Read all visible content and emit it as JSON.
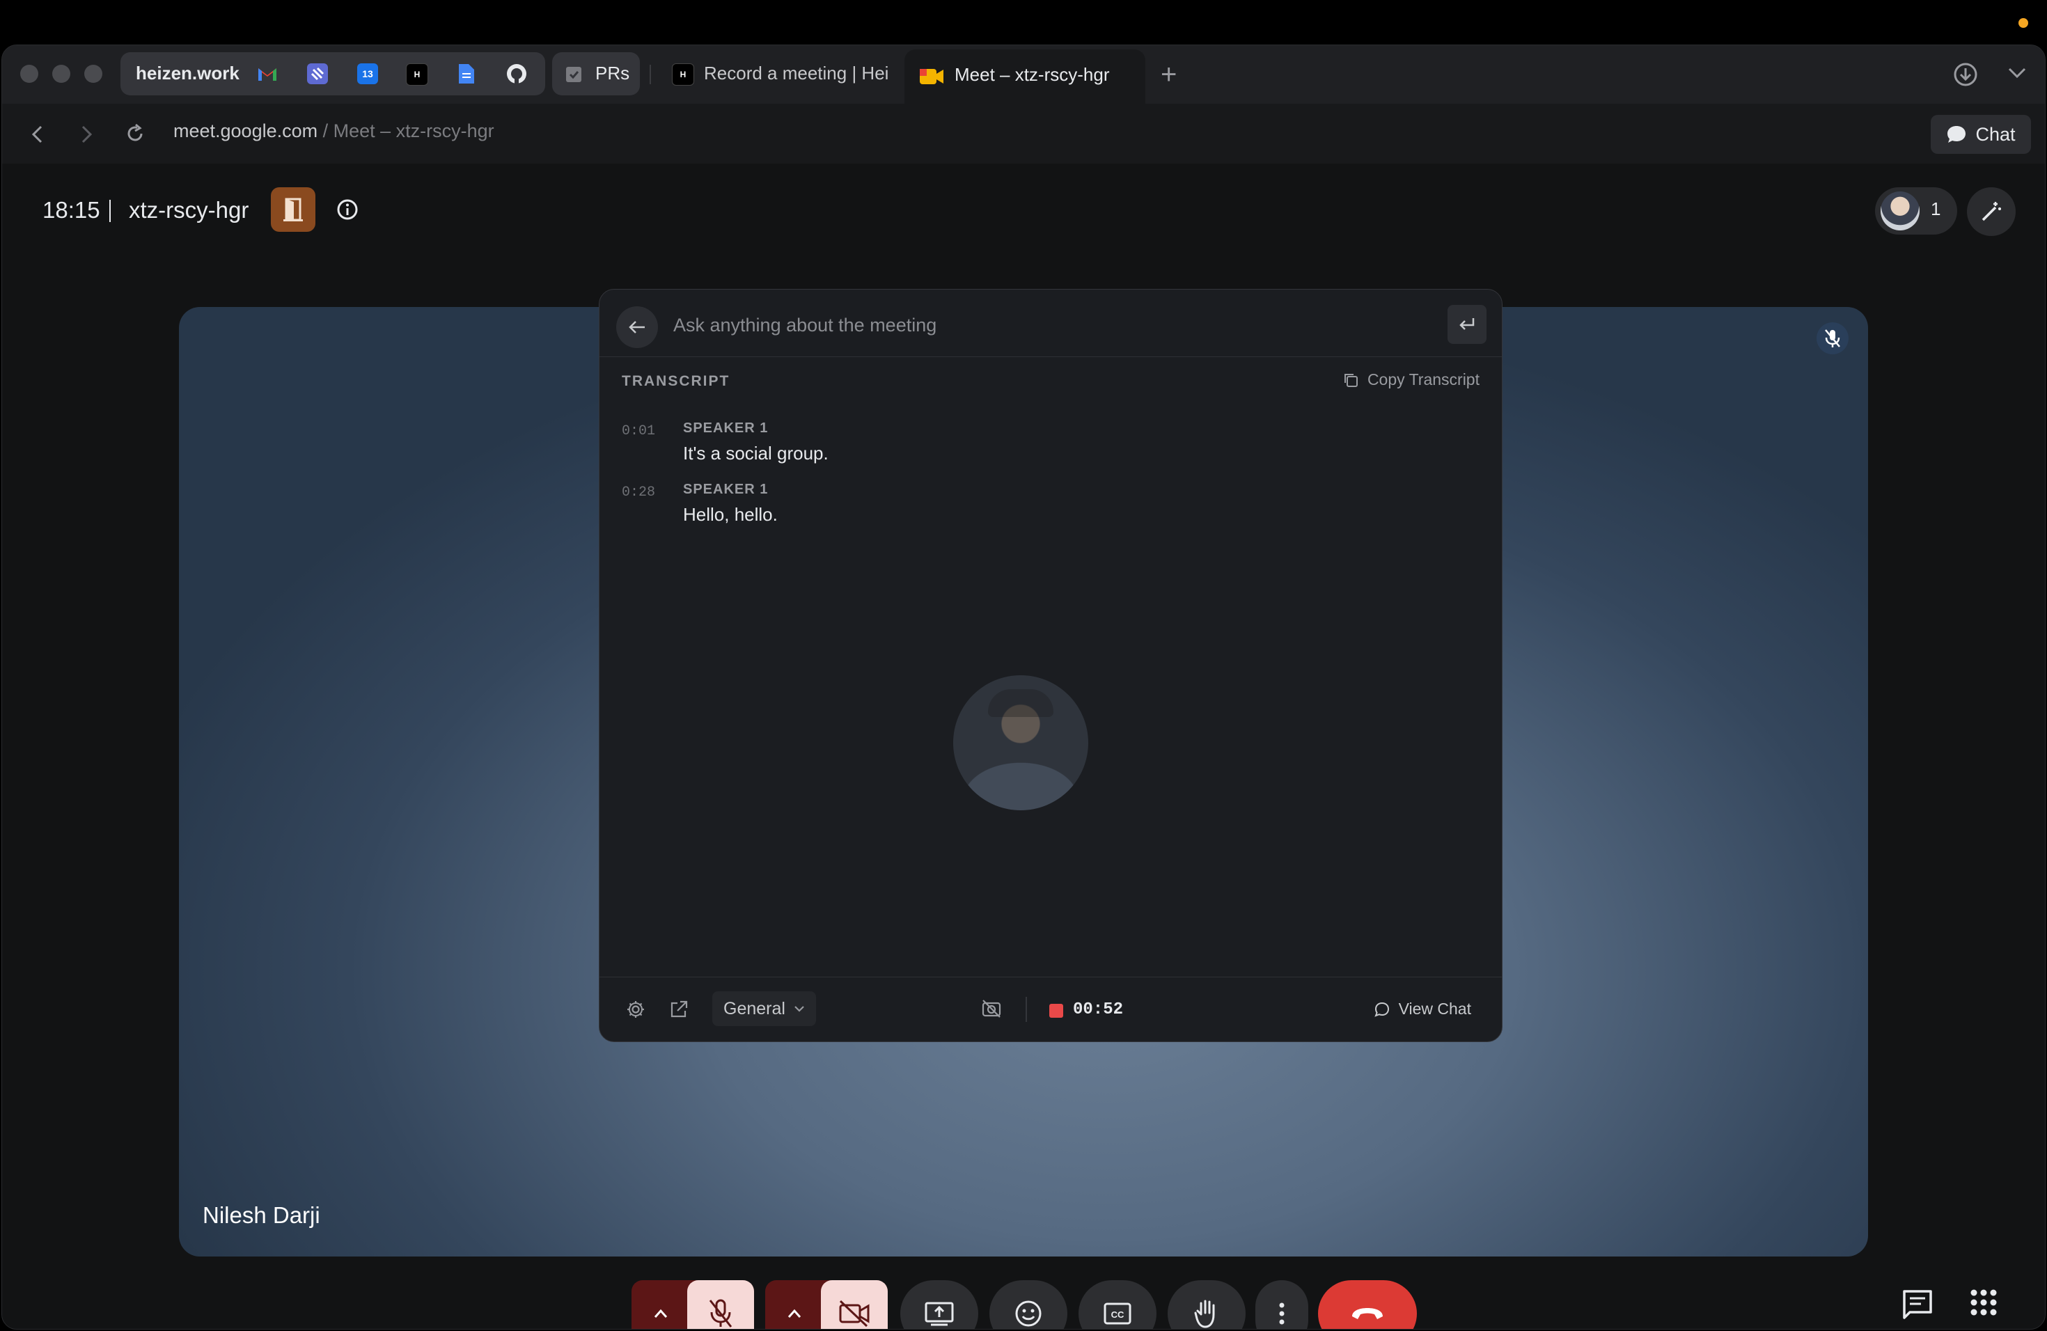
{
  "colors": {
    "accent_recording": "#e94949",
    "end_call": "#dc3a34",
    "muted_control": "#f6d9d7",
    "muted_group": "#5c1616",
    "door_badge": "#8a4a1f",
    "notification_dot": "#f5a623"
  },
  "browser": {
    "pinned_tab": {
      "label": "heizen.work"
    },
    "pinned_icons": [
      "gmail-icon",
      "linear-icon",
      "calendar-icon",
      "heizen-icon",
      "docs-icon",
      "github-icon"
    ],
    "calendar_day": "13",
    "tabs": [
      {
        "label": "PRs",
        "icon": "clipboard-icon"
      },
      {
        "label": "Record a meeting | Hei",
        "icon": "heizen-icon"
      },
      {
        "label": "Meet – xtz-rscy-hgr",
        "icon": "meet-icon",
        "active": true
      }
    ],
    "url": {
      "domain": "meet.google.com",
      "path": " / Meet – xtz-rscy-hgr"
    },
    "chat_button": "Chat"
  },
  "meet": {
    "time": "18:15",
    "meeting_code": "xtz-rscy-hgr",
    "participant_count": "1",
    "tile_name": "Nilesh Darji"
  },
  "assistant": {
    "ask_placeholder": "Ask anything about the meeting",
    "transcript_heading": "TRANSCRIPT",
    "copy_label": "Copy Transcript",
    "entries": [
      {
        "ts": "0:01",
        "speaker": "SPEAKER 1",
        "text": "It's a social group."
      },
      {
        "ts": "0:28",
        "speaker": "SPEAKER 1",
        "text": "Hello, hello."
      }
    ],
    "mode": "General",
    "recording_time": "00:52",
    "view_chat": "View Chat"
  }
}
